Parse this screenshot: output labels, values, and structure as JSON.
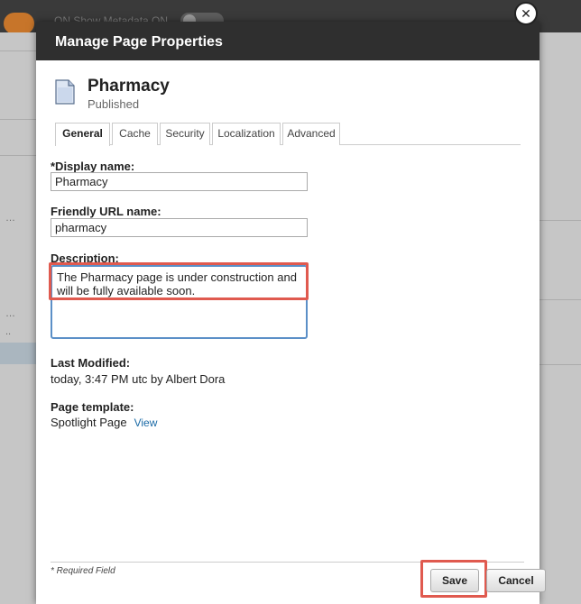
{
  "background": {
    "top_text": "ON    Show Metadata    ON"
  },
  "dialog": {
    "title": "Manage Page Properties",
    "close_icon": "x-circle-icon"
  },
  "page": {
    "name": "Pharmacy",
    "status": "Published",
    "icon": "document-icon"
  },
  "tabs": [
    {
      "label": "General",
      "active": true
    },
    {
      "label": "Cache",
      "active": false
    },
    {
      "label": "Security",
      "active": false
    },
    {
      "label": "Localization",
      "active": false
    },
    {
      "label": "Advanced",
      "active": false
    }
  ],
  "form": {
    "display_name_label": "*Display name:",
    "display_name_value": "Pharmacy",
    "friendly_url_label": "Friendly URL name:",
    "friendly_url_value": "pharmacy",
    "description_label": "Description:",
    "description_value": "The Pharmacy page is under construction and will be fully available soon.",
    "last_modified_label": "Last Modified:",
    "last_modified_value": "today, 3:47 PM utc  by Albert Dora",
    "page_template_label": "Page template:",
    "page_template_value": "Spotlight Page",
    "page_template_link": "View"
  },
  "footer": {
    "required_note": "* Required Field",
    "save_label": "Save",
    "cancel_label": "Cancel"
  },
  "colors": {
    "highlight": "#e05a4f",
    "header": "#2f2f2f",
    "link": "#1a6aa6",
    "focus": "#5b8fc7"
  }
}
